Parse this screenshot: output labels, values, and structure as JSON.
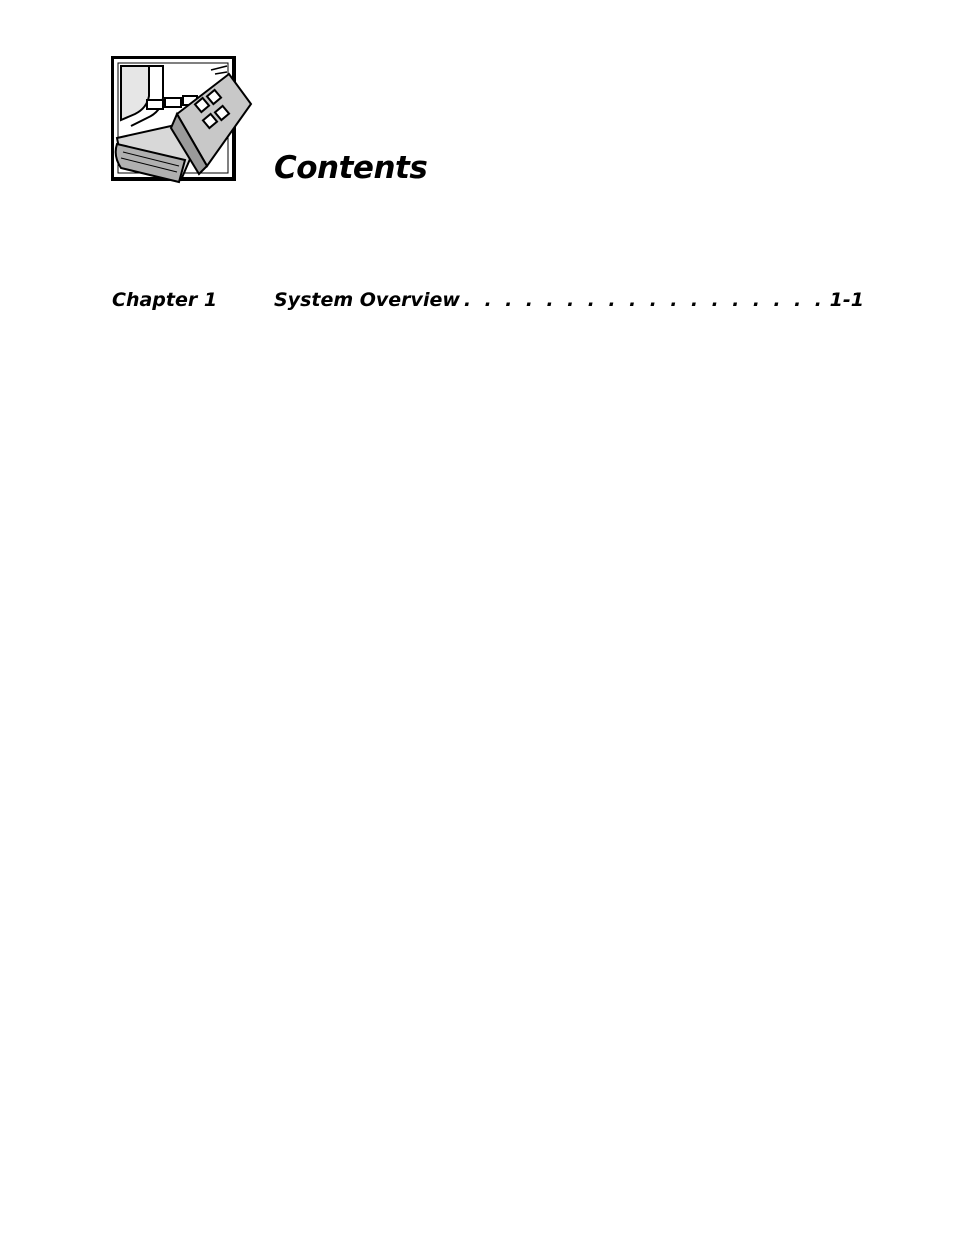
{
  "page": {
    "title": "Contents",
    "logo_icon": "book-and-circuit-board-icon"
  },
  "toc": {
    "entries": [
      {
        "chapter": "Chapter 1",
        "title": "System Overview",
        "leader": ". . . . . . . . . . . . . . . . . . . . . . . . . . . . . . . . . . . . . . . . . . . . . . .",
        "page": "1-1"
      }
    ]
  }
}
